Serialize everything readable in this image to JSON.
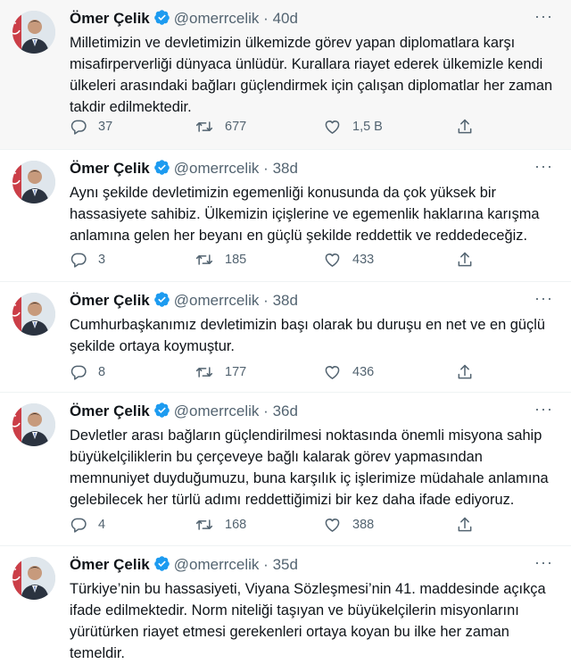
{
  "author": {
    "name": "Ömer Çelik",
    "handle": "@omerrcelik",
    "separator": "·"
  },
  "icons": {
    "verified": "verified-badge-icon",
    "more": "more-options-icon",
    "reply": "reply-icon",
    "retweet": "retweet-icon",
    "like": "heart-icon",
    "share": "share-icon"
  },
  "colors": {
    "verified": "#1d9bf0",
    "muted": "#536471",
    "text": "#0f1419"
  },
  "tweets": [
    {
      "time": "40d",
      "text": "Milletimizin ve devletimizin ülkemizde görev yapan diplomatlara karşı misafirperverliği dünyaca ünlüdür. Kurallara riayet ederek ülkemizle kendi ülkeleri arasındaki bağları güçlendirmek için çalışan diplomatlar her zaman takdir edilmektedir.",
      "replies": "37",
      "retweets": "677",
      "likes": "1,5 B"
    },
    {
      "time": "38d",
      "text": "Aynı şekilde devletimizin egemenliği konusunda da çok yüksek bir hassasiyete sahibiz. Ülkemizin içişlerine ve egemenlik haklarına karışma anlamına gelen her beyanı en güçlü şekilde reddettik ve reddedeceğiz.",
      "replies": "3",
      "retweets": "185",
      "likes": "433"
    },
    {
      "time": "38d",
      "text": "Cumhurbaşkanımız devletimizin başı olarak bu duruşu en net ve en güçlü şekilde ortaya koymuştur.",
      "replies": "8",
      "retweets": "177",
      "likes": "436"
    },
    {
      "time": "36d",
      "text": "Devletler arası bağların güçlendirilmesi noktasında önemli misyona sahip büyükelçiliklerin bu çerçeveye bağlı kalarak görev yapmasından memnuniyet duyduğumuzu, buna karşılık iç işlerimize müdahale anlamına gelebilecek her türlü adımı reddettiğimizi bir kez daha ifade ediyoruz.",
      "replies": "4",
      "retweets": "168",
      "likes": "388"
    },
    {
      "time": "35d",
      "text": "Türkiye’nin bu hassasiyeti, Viyana Sözleşmesi’nin 41. maddesinde açıkça ifade edilmektedir. Norm niteliği taşıyan ve büyükelçilerin misyonlarını yürütürken riayet etmesi gerekenleri ortaya koyan bu ilke her zaman temeldir."
    }
  ]
}
